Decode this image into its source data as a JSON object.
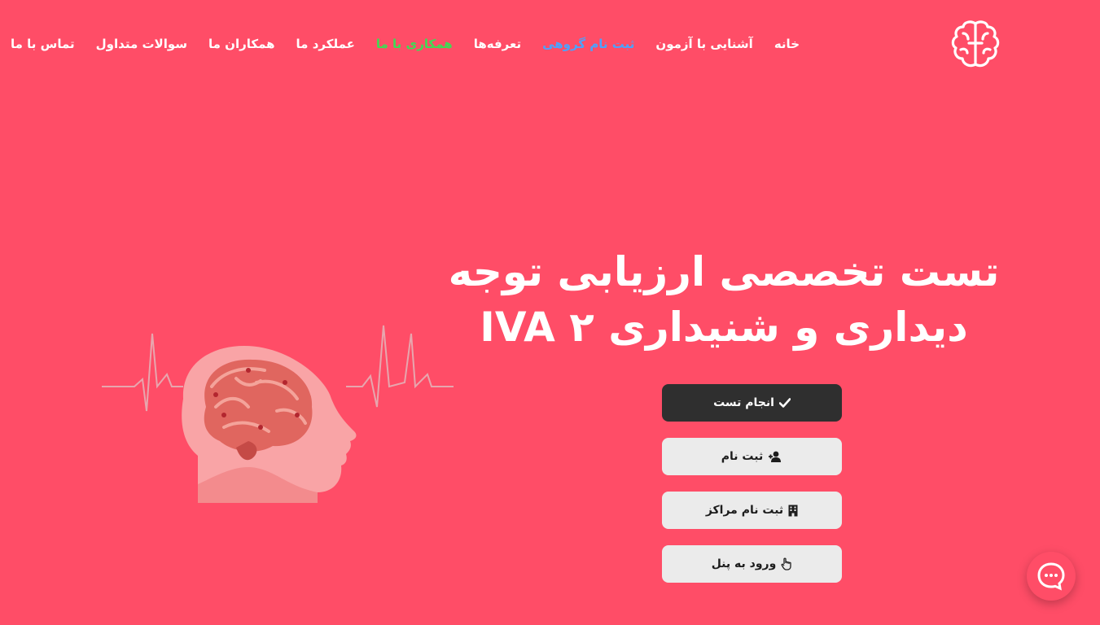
{
  "colors": {
    "background": "#ff4d67",
    "nav_text": "#ffffff",
    "nav_group_highlight": "#4aa3ff",
    "nav_coop_highlight": "#3ddc55",
    "primary_button": "#2f2f2f",
    "secondary_button": "#ebebeb"
  },
  "logo": {
    "icon": "brain-logo-icon"
  },
  "nav": {
    "items": [
      {
        "label": "خانه"
      },
      {
        "label": "آشنایی با آزمون"
      },
      {
        "label": "ثبت نام گروهی"
      },
      {
        "label": "تعرفه‌ها"
      },
      {
        "label": "همکاری با ما"
      },
      {
        "label": "عملکرد ما"
      },
      {
        "label": "همکاران ما"
      },
      {
        "label": "سوالات متداول"
      },
      {
        "label": "تماس با ما"
      }
    ]
  },
  "hero": {
    "title_line1": "تست تخصصی ارزیابی توجه",
    "title_line2": "دیداری و شنیداری ۲ IVA"
  },
  "buttons": {
    "start_test": {
      "label": "انجام تست",
      "icon": "check-icon"
    },
    "register": {
      "label": "ثبت نام",
      "icon": "user-plus-icon"
    },
    "register_centers": {
      "label": "ثبت نام مراکز",
      "icon": "building-icon"
    },
    "panel_login": {
      "label": "ورود به پنل",
      "icon": "hand-pointer-icon"
    }
  },
  "chat": {
    "icon": "chat-bubble-icon"
  }
}
